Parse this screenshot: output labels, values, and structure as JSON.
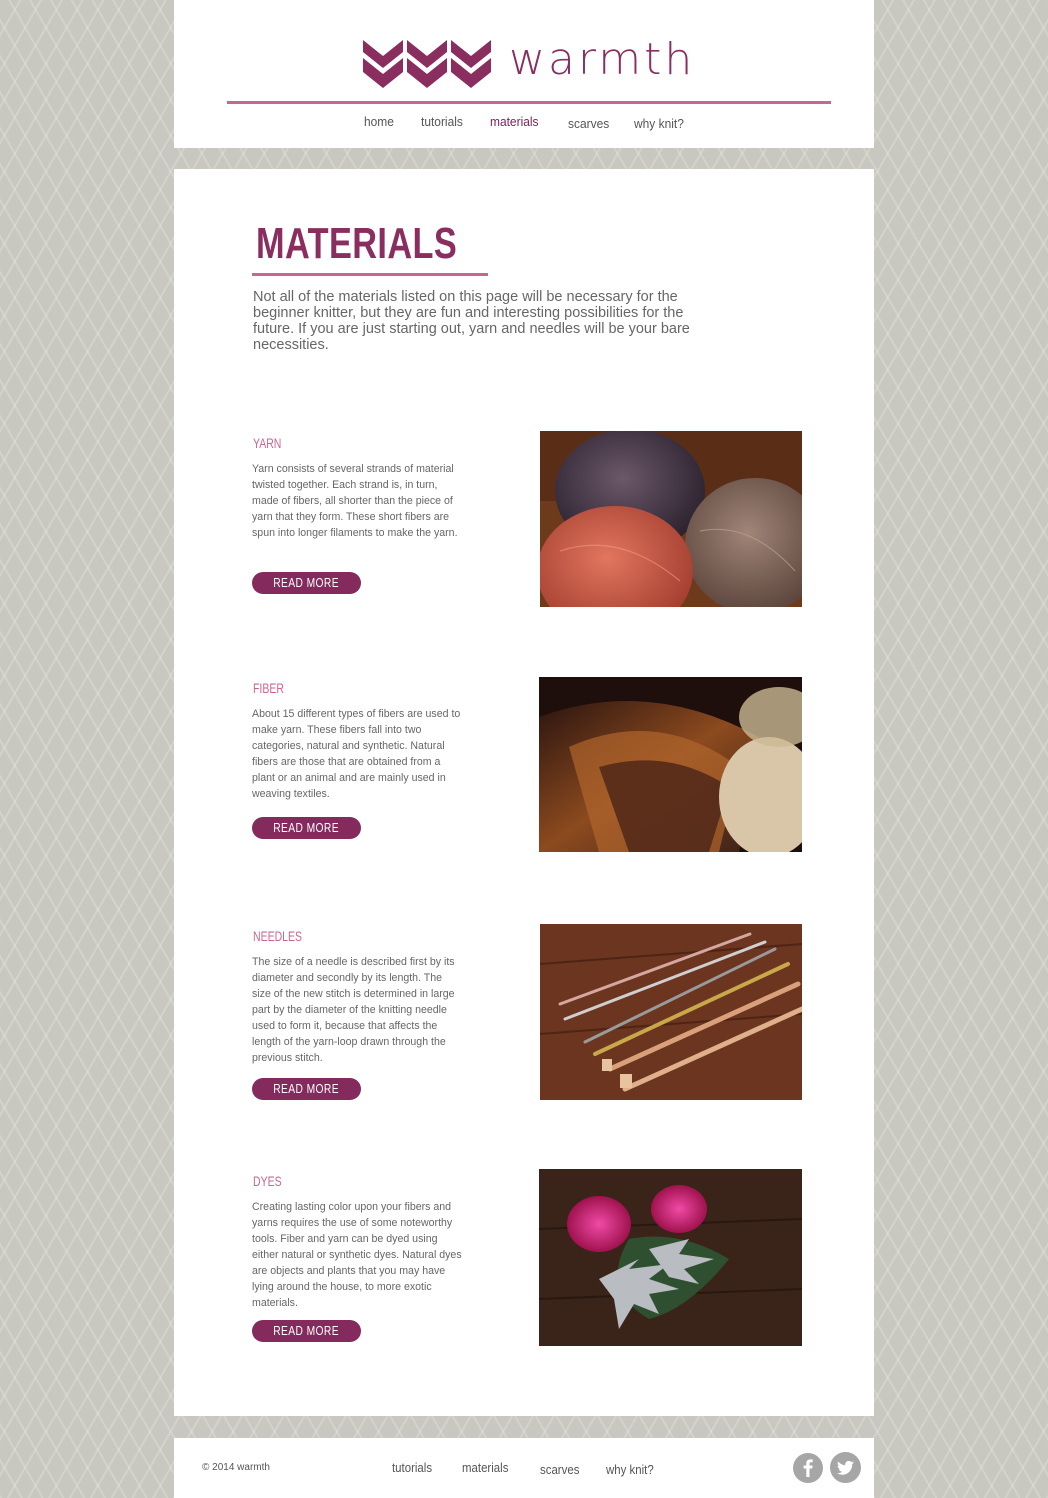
{
  "brand": {
    "name": "warmth"
  },
  "nav": {
    "items": [
      {
        "label": "home"
      },
      {
        "label": "tutorials"
      },
      {
        "label": "materials",
        "active": true
      },
      {
        "label": "scarves"
      },
      {
        "label": "why knit?"
      }
    ]
  },
  "page": {
    "title": "MATERIALS",
    "intro": "Not all of the materials listed on this page will be necessary for the beginner knitter, but they are fun and interesting possibilities for the future. If you are just starting out, yarn and needles will be your bare necessities."
  },
  "items": [
    {
      "title": "YARN",
      "description": "Yarn consists of several strands of material twisted together. Each strand is, in turn, made of fibers, all shorter than the piece of yarn that they form. These short fibers are spun into longer filaments to make the yarn.",
      "button": "READ MORE",
      "image": "yarn-balls-photo"
    },
    {
      "title": "FIBER",
      "description": "About 15 different types of fibers are used to make yarn. These fibers fall into two categories, natural and synthetic. Natural fibers are those that are obtained from a plant or an animal and are mainly used in weaving textiles.",
      "button": "READ MORE",
      "image": "wool-fiber-photo"
    },
    {
      "title": "NEEDLES",
      "description": "The size of a needle is described first by its diameter and secondly by its length. The size of the new stitch is determined in large part by the diameter of the knitting needle used to form it, because that affects the length of the yarn-loop drawn through the previous stitch.",
      "button": "READ MORE",
      "image": "knitting-needles-photo"
    },
    {
      "title": "DYES",
      "description": "Creating lasting color upon your fibers and yarns requires the use of some noteworthy tools. Fiber and yarn can be dyed using either natural or synthetic dyes. Natural dyes are objects and plants that you may have lying around the house, to more exotic materials.",
      "button": "READ MORE",
      "image": "roses-and-leaves-photo"
    }
  ],
  "footer": {
    "copyright": "© 2014 warmth",
    "links": [
      {
        "label": "tutorials"
      },
      {
        "label": "materials"
      },
      {
        "label": "scarves"
      },
      {
        "label": "why knit?"
      }
    ],
    "social": [
      "facebook-icon",
      "twitter-icon"
    ]
  },
  "colors": {
    "brand": "#8a2d5f",
    "accent": "#c9668f",
    "button": "#842a5c",
    "background": "#c9c8c0"
  }
}
